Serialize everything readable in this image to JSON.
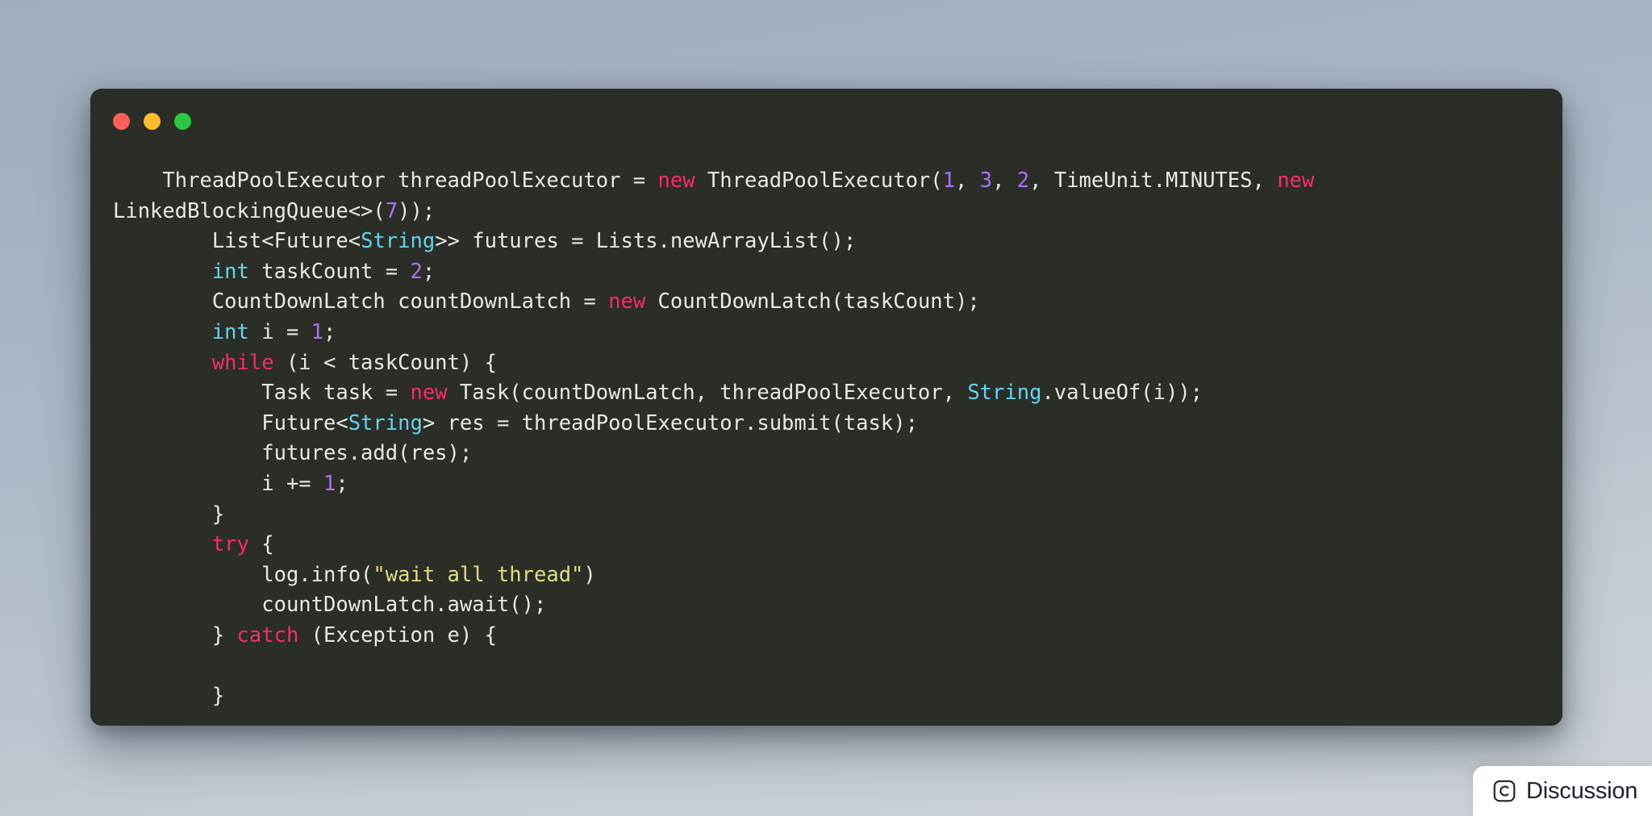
{
  "window": {
    "traffic_lights": [
      {
        "name": "close",
        "color": "#ff5f57"
      },
      {
        "name": "minimize",
        "color": "#febc2e"
      },
      {
        "name": "maximize",
        "color": "#28c840"
      }
    ]
  },
  "editor": {
    "language": "java",
    "theme": {
      "background": "#2b2d27",
      "foreground": "#e9e9e4",
      "keyword": "#f92a6e",
      "type": "#5fd7ef",
      "number": "#a973f5",
      "string": "#e3dd84"
    },
    "tokens": [
      {
        "t": "    ThreadPoolExecutor threadPoolExecutor = ",
        "c": "pln"
      },
      {
        "t": "new",
        "c": "kw"
      },
      {
        "t": " ThreadPoolExecutor(",
        "c": "pln"
      },
      {
        "t": "1",
        "c": "num"
      },
      {
        "t": ", ",
        "c": "pln"
      },
      {
        "t": "3",
        "c": "num"
      },
      {
        "t": ", ",
        "c": "pln"
      },
      {
        "t": "2",
        "c": "num"
      },
      {
        "t": ", TimeUnit.MINUTES, ",
        "c": "pln"
      },
      {
        "t": "new",
        "c": "kw"
      },
      {
        "t": " LinkedBlockingQueue<>(",
        "c": "pln"
      },
      {
        "t": "7",
        "c": "num"
      },
      {
        "t": "));\n        List<Future<",
        "c": "pln"
      },
      {
        "t": "String",
        "c": "typ"
      },
      {
        "t": ">> futures = Lists.newArrayList();\n        ",
        "c": "pln"
      },
      {
        "t": "int",
        "c": "typ"
      },
      {
        "t": " taskCount = ",
        "c": "pln"
      },
      {
        "t": "2",
        "c": "num"
      },
      {
        "t": ";\n        CountDownLatch countDownLatch = ",
        "c": "pln"
      },
      {
        "t": "new",
        "c": "kw"
      },
      {
        "t": " CountDownLatch(taskCount);\n        ",
        "c": "pln"
      },
      {
        "t": "int",
        "c": "typ"
      },
      {
        "t": " i = ",
        "c": "pln"
      },
      {
        "t": "1",
        "c": "num"
      },
      {
        "t": ";\n        ",
        "c": "pln"
      },
      {
        "t": "while",
        "c": "kw"
      },
      {
        "t": " (i < taskCount) {\n            Task task = ",
        "c": "pln"
      },
      {
        "t": "new",
        "c": "kw"
      },
      {
        "t": " Task(countDownLatch, threadPoolExecutor, ",
        "c": "pln"
      },
      {
        "t": "String",
        "c": "typ"
      },
      {
        "t": ".valueOf(i));\n            Future<",
        "c": "pln"
      },
      {
        "t": "String",
        "c": "typ"
      },
      {
        "t": "> res = threadPoolExecutor.submit(task);\n            futures.add(res);\n            i += ",
        "c": "pln"
      },
      {
        "t": "1",
        "c": "num"
      },
      {
        "t": ";\n        }\n        ",
        "c": "pln"
      },
      {
        "t": "try",
        "c": "kw"
      },
      {
        "t": " {\n            log.info(",
        "c": "pln"
      },
      {
        "t": "\"wait all thread\"",
        "c": "str"
      },
      {
        "t": ")\n            countDownLatch.await();\n        } ",
        "c": "pln"
      },
      {
        "t": "catch",
        "c": "kw"
      },
      {
        "t": " (Exception e) {\n\n        }",
        "c": "pln"
      }
    ],
    "plain_text": "    ThreadPoolExecutor threadPoolExecutor = new ThreadPoolExecutor(1, 3, 2, TimeUnit.MINUTES, new LinkedBlockingQueue<>(7));\n        List<Future<String>> futures = Lists.newArrayList();\n        int taskCount = 2;\n        CountDownLatch countDownLatch = new CountDownLatch(taskCount);\n        int i = 1;\n        while (i < taskCount) {\n            Task task = new Task(countDownLatch, threadPoolExecutor, String.valueOf(i));\n            Future<String> res = threadPoolExecutor.submit(task);\n            futures.add(res);\n            i += 1;\n        }\n        try {\n            log.info(\"wait all thread\")\n            countDownLatch.await();\n        } catch (Exception e) {\n\n        }"
  },
  "discussion_badge": {
    "label": "Discussion",
    "icon": "circled-c-icon"
  }
}
